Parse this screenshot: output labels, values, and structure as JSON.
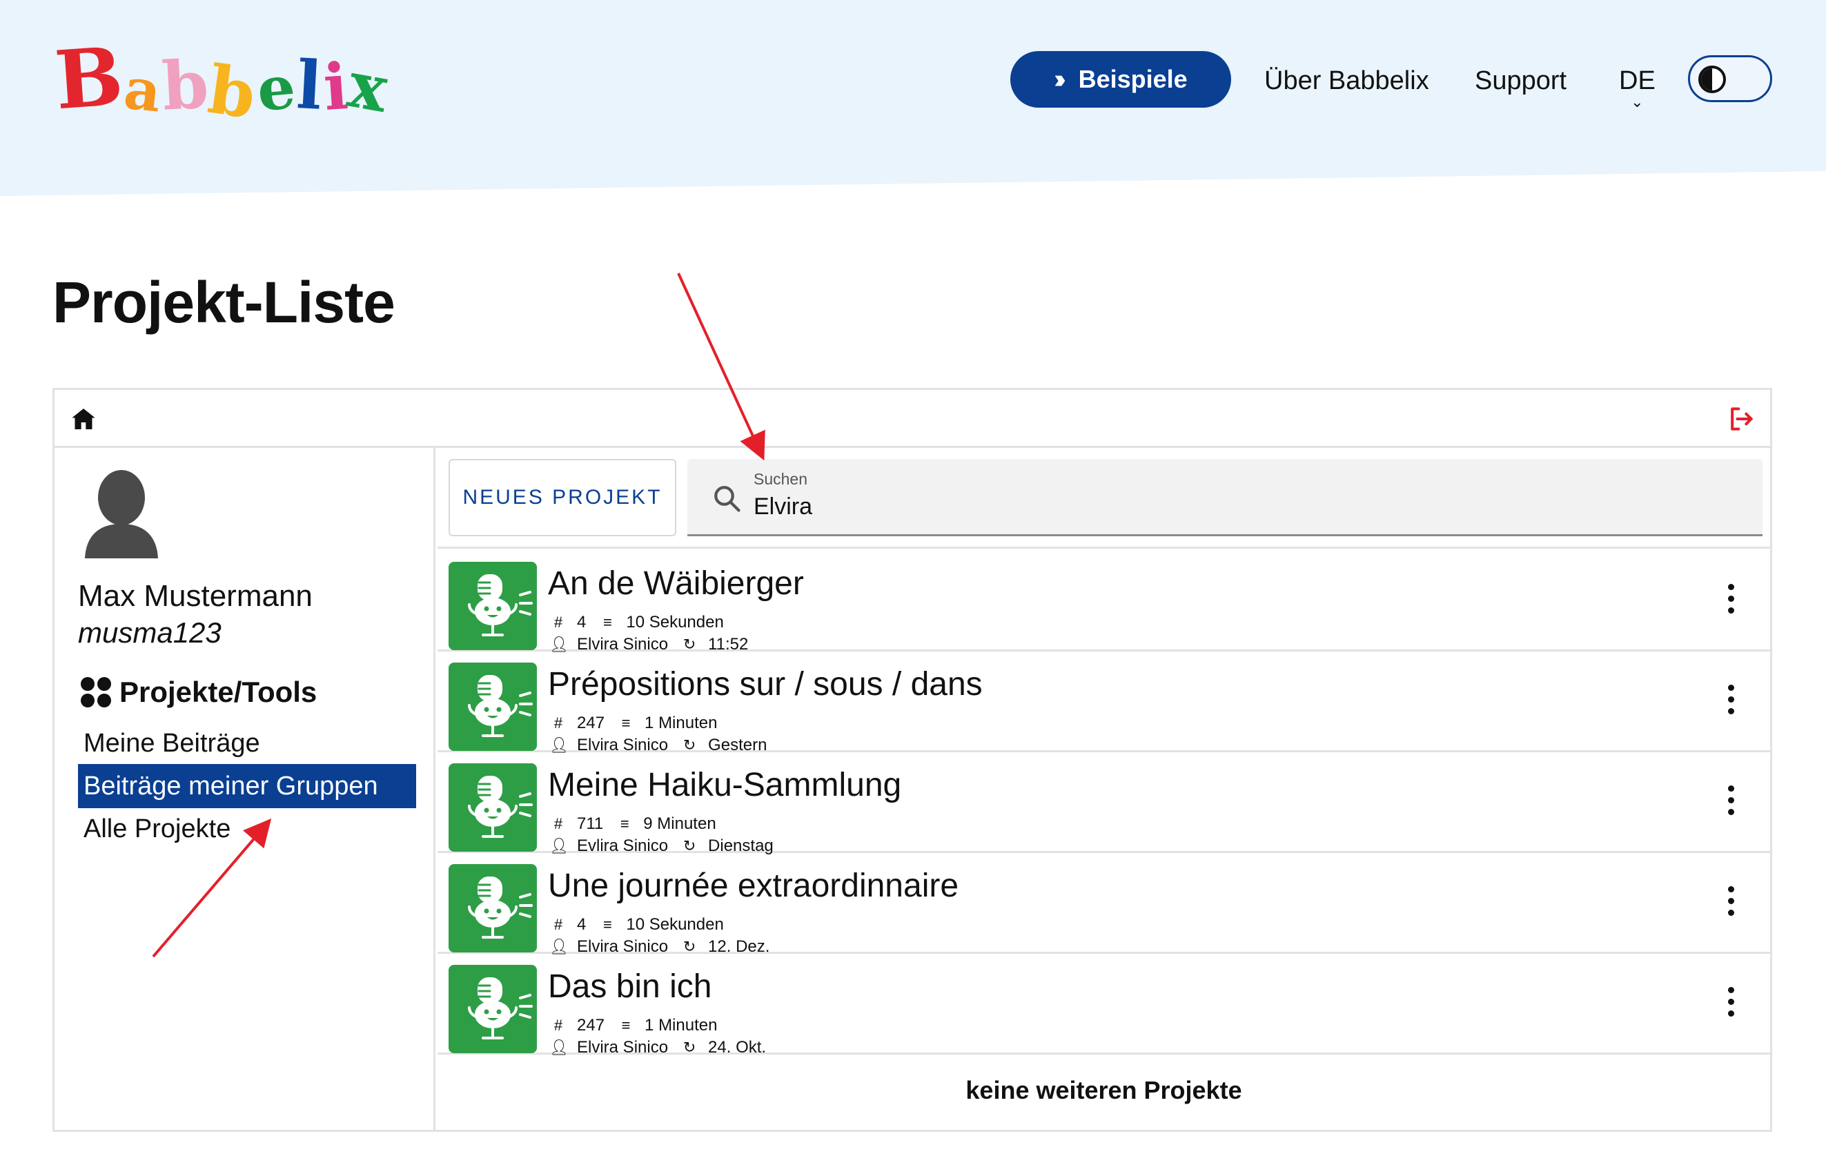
{
  "header": {
    "logo_text": "Babbelix",
    "logo_letters": [
      "B",
      "a",
      "b",
      "b",
      "e",
      "l",
      "i",
      "x"
    ],
    "cta_label": "Beispiele",
    "nav": [
      "Über Babbelix",
      "Support"
    ],
    "language": "DE",
    "colors": {
      "header_bg": "#eaf4fc",
      "primary": "#0a3f92",
      "thumb": "#2e9e46",
      "annotation": "#e3202a"
    }
  },
  "page": {
    "title": "Projekt-Liste"
  },
  "user": {
    "name": "Max Mustermann",
    "handle": "musma123"
  },
  "sidebar": {
    "section_title": "Projekte/Tools",
    "items": [
      {
        "label": "Meine Beiträge",
        "active": false
      },
      {
        "label": "Beiträge meiner Gruppen",
        "active": true
      },
      {
        "label": "Alle Projekte",
        "active": false
      }
    ]
  },
  "toolbar": {
    "new_project_label": "NEUES PROJEKT",
    "search_label": "Suchen",
    "search_value": "Elvira"
  },
  "projects": [
    {
      "title": "An de Wäibierger",
      "count": "4",
      "duration": "10 Sekunden",
      "author": "Elvira Sinico",
      "date": "11:52"
    },
    {
      "title": "Prépositions sur / sous / dans",
      "count": "247",
      "duration": "1 Minuten",
      "author": "Elvira Sinico",
      "date": "Gestern"
    },
    {
      "title": "Meine Haiku-Sammlung",
      "count": "711",
      "duration": "9 Minuten",
      "author": "Evlira Sinico",
      "date": "Dienstag"
    },
    {
      "title": "Une journée extraordinnaire",
      "count": "4",
      "duration": "10 Sekunden",
      "author": "Elvira Sinico",
      "date": "12. Dez."
    },
    {
      "title": "Das bin ich",
      "count": "247",
      "duration": "1 Minuten",
      "author": "Elvira Sinico",
      "date": "24. Okt."
    }
  ],
  "list_end": "keine weiteren Projekte",
  "icons": {
    "home": "home-icon",
    "logout": "logout-icon",
    "search": "search-icon",
    "count": "hash-icon",
    "duration": "list-icon",
    "author": "person-icon",
    "date": "history-icon",
    "menu": "more-vertical-icon",
    "thumb": "microphone-icon"
  }
}
